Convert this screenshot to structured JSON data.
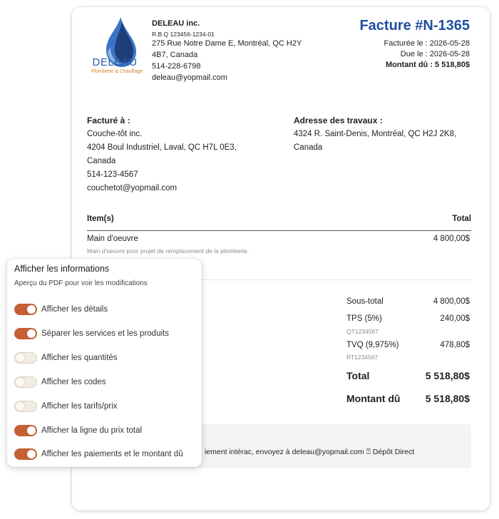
{
  "company": {
    "logo_text": "DELEAU",
    "logo_subtitle": "Plomberie & Chauffage",
    "name": "DELEAU inc.",
    "rbq": "R.B.Q 123456-1234-01",
    "address_line1": "275 Rue Notre Dame E, Montréal, QC H2Y",
    "address_line2": "4B7, Canada",
    "phone": "514-228-6798",
    "email": "deleau@yopmail.com"
  },
  "invoice": {
    "title": "Facture #N-1365",
    "billed_date": "Facturée le : 2026-05-28",
    "due_date": "Due le : 2026-05-28",
    "amount_due": "Montant dû : 5 518,80$"
  },
  "billed_to": {
    "heading": "Facturé à :",
    "name": "Couche-tôt inc.",
    "address_line1": "4204 Boul Industriel, Laval, QC H7L 0E3,",
    "address_line2": "Canada",
    "phone": "514-123-4567",
    "email": "couchetot@yopmail.com"
  },
  "work_address": {
    "heading": "Adresse des travaux :",
    "line1": "4324 R. Saint-Denis, Montréal, QC H2J 2K8,",
    "line2": "Canada"
  },
  "items": {
    "header_item": "Item(s)",
    "header_total": "Total",
    "rows": [
      {
        "name": "Main d'oeuvre",
        "description": "Main d'oeuvre pour projet de remplacement de la plomberie.",
        "total": "4 800,00$"
      }
    ]
  },
  "totals": {
    "subtotal_label": "Sous-total",
    "subtotal_value": "4 800,00$",
    "tps_label": "TPS (5%)",
    "tps_number": "QT1234567",
    "tps_value": "240,00$",
    "tvq_label": "TVQ (9,975%)",
    "tvq_number": "RT1234567",
    "tvq_value": "478,80$",
    "total_label": "Total",
    "total_value": "5 518,80$",
    "due_label": "Montant dû",
    "due_value": "5 518,80$"
  },
  "footer": {
    "payment_text": "iement intérac, envoyez à deleau@yopmail.com ⍰ Dépôt Direct"
  },
  "panel": {
    "title": "Afficher les informations",
    "subtitle": "Aperçu du PDF pour voir les modifications",
    "toggles": [
      {
        "label": "Afficher les détails",
        "on": true
      },
      {
        "label": "Séparer les services et les produits",
        "on": true
      },
      {
        "label": "Afficher les quantités",
        "on": false
      },
      {
        "label": "Afficher les codes",
        "on": false
      },
      {
        "label": "Afficher les tarifs/prix",
        "on": false
      },
      {
        "label": "Afficher la ligne du prix total",
        "on": true
      },
      {
        "label": "Afficher les paiements et le montant dû",
        "on": true
      }
    ]
  },
  "colors": {
    "accent_blue": "#1f4f9e",
    "toggle_on": "#c65f33",
    "logo_text": "#2d5da8",
    "logo_subtitle": "#d9822b"
  },
  "icons": [
    "water-drop-logo-icon"
  ]
}
